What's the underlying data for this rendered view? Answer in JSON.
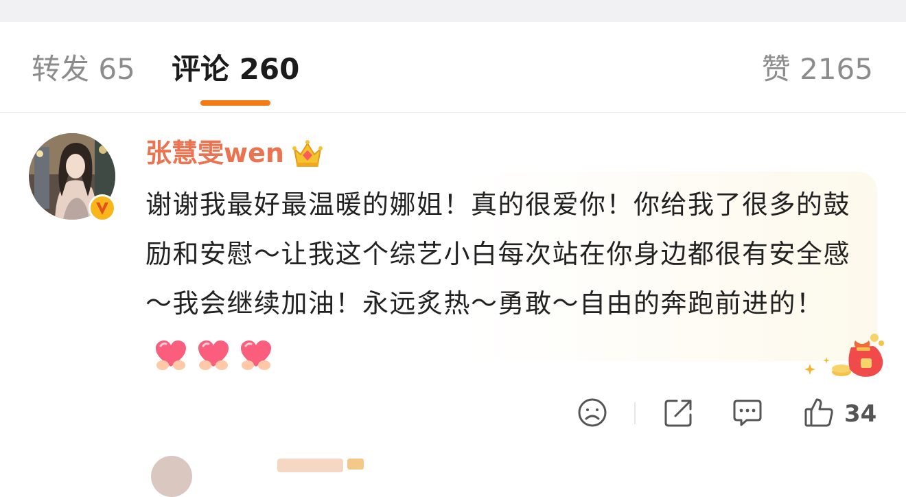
{
  "tabs": {
    "reposts": "转发 65",
    "comments": "评论 260",
    "likes": "赞 2165"
  },
  "comment": {
    "username": "张慧雯wen",
    "text": "谢谢我最好最温暖的娜姐！真的很爱你！你给我了很多的鼓励和安慰～让我这个综艺小白每次站在你身边都很有安全感～我会继续加油！永远炙热～勇敢～自由的奔跑前进的！",
    "emoji": [
      "heart-hands",
      "heart-hands",
      "heart-hands"
    ],
    "like_count": "34"
  },
  "colors": {
    "accent": "#f37b12",
    "username": "#eb7350",
    "text": "#222222",
    "muted": "#8c8c8c"
  },
  "icons": {
    "avatar_badge": "verified-v-icon",
    "user_badge": "crown-icon",
    "decoration": "lucky-bag-icon",
    "actions": [
      "dislike-face-icon",
      "share-icon",
      "comment-icon",
      "like-thumb-icon"
    ]
  }
}
